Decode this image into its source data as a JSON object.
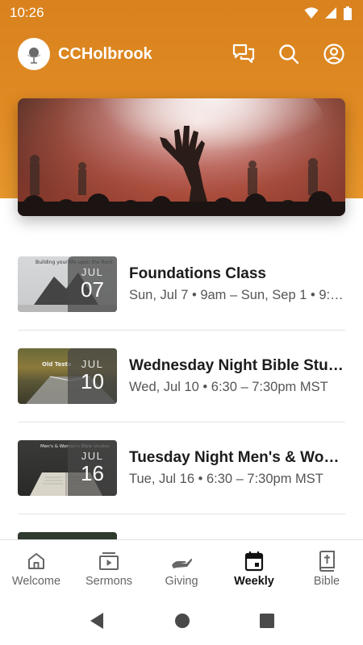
{
  "status_bar": {
    "time": "10:26"
  },
  "app": {
    "title": "CCHolbrook"
  },
  "events": [
    {
      "title": "Foundations Class",
      "subtitle": "Sun, Jul 7 • 9am – Sun, Sep 1 • 9:…",
      "month": "JUL",
      "day": "07",
      "thumb_text": "Building your life upon the Rock"
    },
    {
      "title": "Wednesday Night Bible Study",
      "subtitle": "Wed, Jul 10 • 6:30 – 7:30pm MST",
      "month": "JUL",
      "day": "10",
      "thumb_text": "Old Testa"
    },
    {
      "title": "Tuesday Night Men's & Wo…",
      "subtitle": "Tue, Jul 16 • 6:30 – 7:30pm MST",
      "month": "JUL",
      "day": "16",
      "thumb_text": "Men's & Women's Bible studies"
    }
  ],
  "bottom_nav": [
    {
      "label": "Welcome",
      "icon": "home-icon"
    },
    {
      "label": "Sermons",
      "icon": "video-icon"
    },
    {
      "label": "Giving",
      "icon": "giving-hand-icon"
    },
    {
      "label": "Weekly",
      "icon": "calendar-icon",
      "active": true
    },
    {
      "label": "Bible",
      "icon": "bible-icon"
    }
  ],
  "colors": {
    "brand": "#e08b24",
    "text": "#1c1c1c",
    "muted": "#555555"
  }
}
